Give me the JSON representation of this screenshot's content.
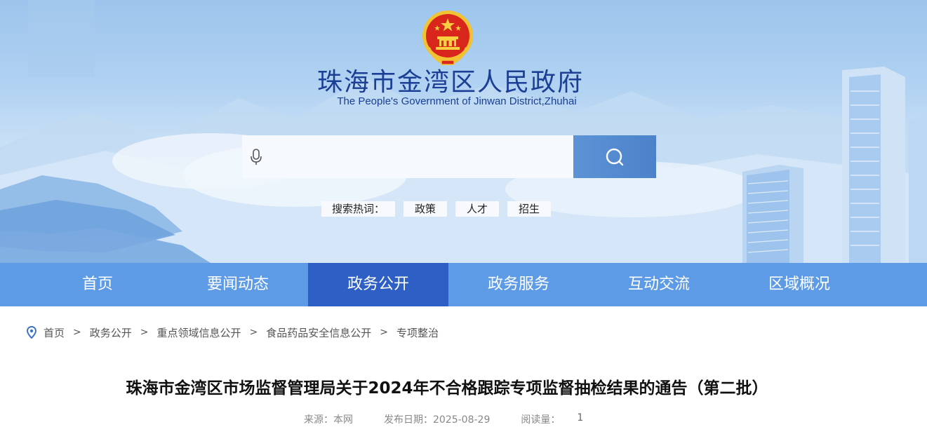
{
  "header": {
    "title_cn": "珠海市金湾区人民政府",
    "title_en": "The People's Government of Jinwan District,Zhuhai"
  },
  "search": {
    "placeholder": "",
    "hot_label": "搜索热词：",
    "hot_words": [
      "政策",
      "人才",
      "招生"
    ]
  },
  "nav": {
    "items": [
      {
        "label": "首页"
      },
      {
        "label": "要闻动态"
      },
      {
        "label": "政务公开"
      },
      {
        "label": "政务服务"
      },
      {
        "label": "互动交流"
      },
      {
        "label": "区域概况"
      }
    ],
    "active_index": 2
  },
  "breadcrumb": [
    "首页",
    "政务公开",
    "重点领域信息公开",
    "食品药品安全信息公开",
    "专项整治"
  ],
  "breadcrumb_separator": ">",
  "article": {
    "title": "珠海市金湾区市场监督管理局关于2024年不合格跟踪专项监督抽检结果的通告（第二批）",
    "source": "来源：本网",
    "date": "发布日期：2025-08-29",
    "views_label": "阅读量：",
    "views_count": "1"
  },
  "colors": {
    "nav_bg": "#5e9be6",
    "nav_active": "#2e5fc4",
    "title_blue": "#1b3f94",
    "search_button": "#4b82c9"
  },
  "icons": {
    "emblem": "national-emblem",
    "mic": "microphone-icon",
    "search": "search-icon",
    "location": "location-pin-icon"
  }
}
